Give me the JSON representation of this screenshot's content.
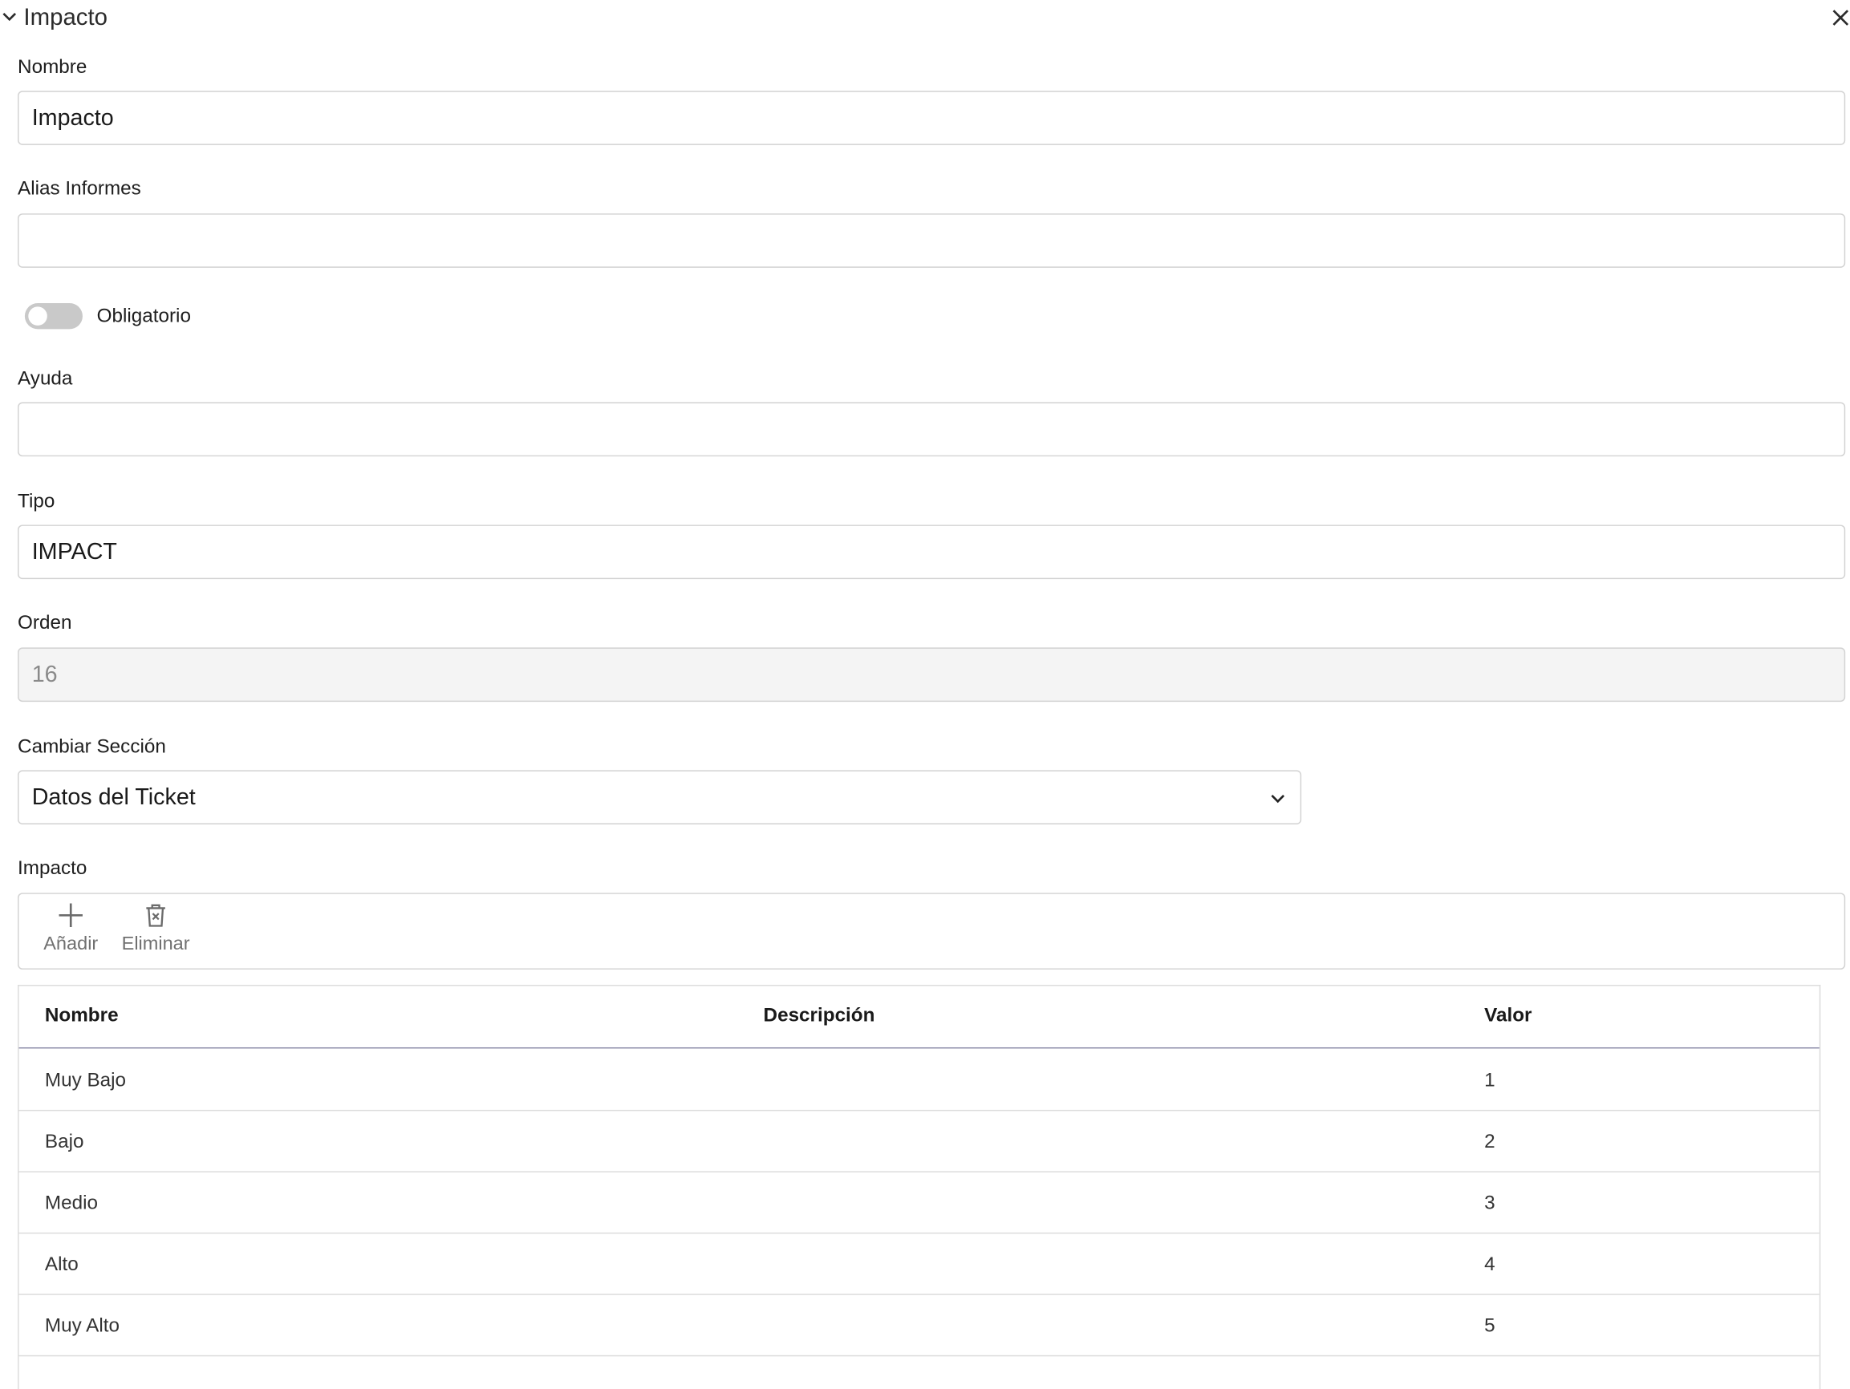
{
  "header": {
    "title": "Impacto"
  },
  "fields": {
    "nombre": {
      "label": "Nombre",
      "value": "Impacto"
    },
    "alias": {
      "label": "Alias Informes",
      "value": ""
    },
    "obligatorio": {
      "label": "Obligatorio",
      "checked": false
    },
    "ayuda": {
      "label": "Ayuda",
      "value": ""
    },
    "tipo": {
      "label": "Tipo",
      "value": "IMPACT"
    },
    "orden": {
      "label": "Orden",
      "value": "16"
    },
    "seccion": {
      "label": "Cambiar Sección",
      "value": "Datos del Ticket"
    }
  },
  "impacto": {
    "label": "Impacto",
    "toolbar": {
      "add_label": "Añadir",
      "delete_label": "Eliminar"
    },
    "columns": [
      "Nombre",
      "Descripción",
      "Valor"
    ],
    "rows": [
      {
        "nombre": "Muy Bajo",
        "descripcion": "",
        "valor": "1"
      },
      {
        "nombre": "Bajo",
        "descripcion": "",
        "valor": "2"
      },
      {
        "nombre": "Medio",
        "descripcion": "",
        "valor": "3"
      },
      {
        "nombre": "Alto",
        "descripcion": "",
        "valor": "4"
      },
      {
        "nombre": "Muy Alto",
        "descripcion": "",
        "valor": "5"
      }
    ]
  }
}
